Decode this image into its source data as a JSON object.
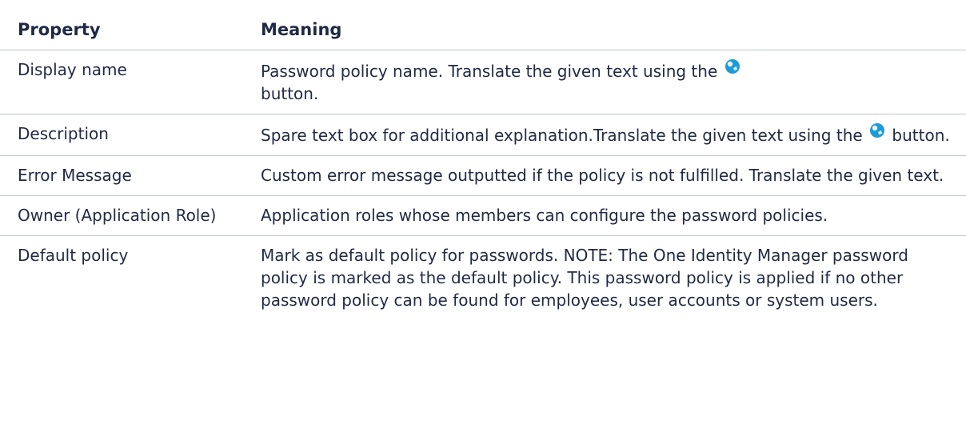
{
  "table": {
    "headers": [
      "Property",
      "Meaning"
    ],
    "rows": [
      {
        "property": "Display name",
        "meaning_before": "Password policy name. Translate the given text using the",
        "icon": "translate-globe-icon",
        "meaning_after": "button."
      },
      {
        "property": "Description",
        "meaning_before": "Spare text box for additional explanation.Translate the given text using the",
        "icon": "translate-globe-icon",
        "meaning_after": "button."
      },
      {
        "property": "Error Message",
        "meaning": "Custom error message outputted if the policy is not fulfilled. Translate the given text."
      },
      {
        "property": "Owner (Application Role)",
        "meaning": "Application roles whose members can configure the password policies."
      },
      {
        "property": "Default policy",
        "meaning": "Mark as default policy for passwords. NOTE: The One Identity Manager password policy is marked as the default policy. This password policy is applied if no other password policy can be found for employees, user accounts or system users."
      }
    ]
  },
  "colors": {
    "text": "#1f2a44",
    "border": "#bfc4cc",
    "icon": "#1e9ad6"
  }
}
